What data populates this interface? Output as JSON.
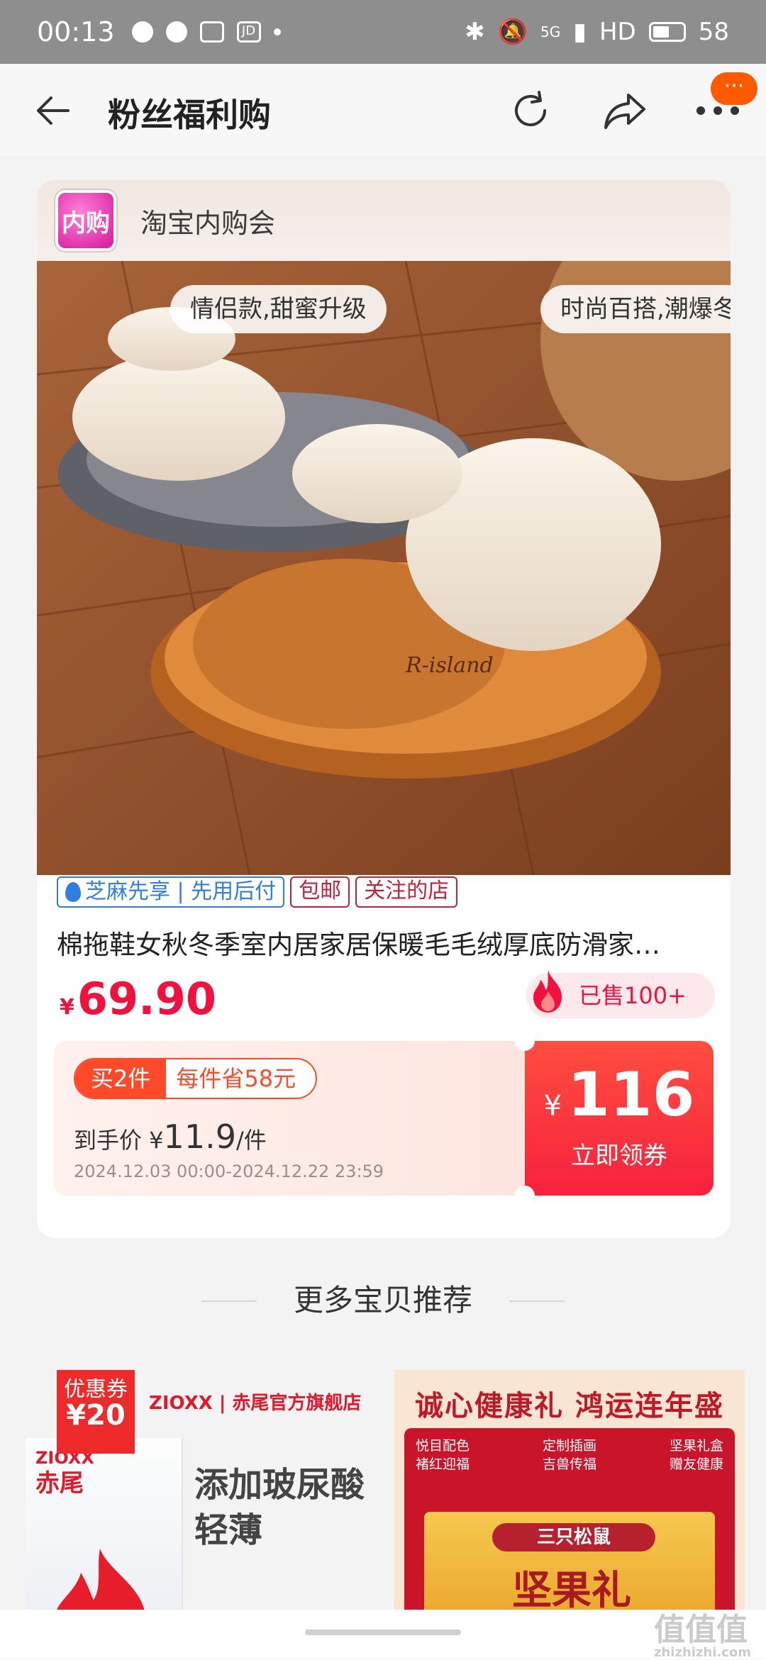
{
  "status_bar": {
    "time": "00:13",
    "network": "5G",
    "hd_label": "HD",
    "battery": "58",
    "jd_label": "JD"
  },
  "nav": {
    "title": "粉丝福利购",
    "badge": "···"
  },
  "shop": {
    "logo_text": "内购",
    "name": "淘宝内购会"
  },
  "product": {
    "tags": [
      "情侣款,甜蜜升级",
      "时尚百搭,潮爆冬"
    ],
    "shoe_brand_text": "R-island",
    "badges": {
      "zhima": "芝麻先享 | 先用后付",
      "free_ship": "包邮",
      "followed": "关注的店"
    },
    "title": "棉拖鞋女秋冬季室内居家居保暖毛毛绒厚底防滑家…",
    "price_symbol": "¥",
    "price": "69.90",
    "sold": "已售100+"
  },
  "coupon": {
    "buy_label": "买2件",
    "save_label": "每件省58元",
    "final_prefix": "到手价 ¥",
    "final_price": "11.9",
    "final_unit": "/件",
    "valid_range": "2024.12.03 00:00-2024.12.22 23:59",
    "amount_symbol": "¥",
    "amount": "116",
    "action": "立即领券"
  },
  "more": {
    "heading": "更多宝贝推荐"
  },
  "recommend": [
    {
      "coupon_label": "优惠券",
      "coupon_value": "¥20",
      "store": "ZIOXX | 赤尾官方旗舰店",
      "brand": "ZIOXX",
      "brand_cn": "赤尾",
      "text_line1": "添加玻尿酸",
      "text_line2": "轻薄"
    },
    {
      "title": "诚心健康礼 鸿运连年盛",
      "features": [
        [
          "悦目配色",
          "褚红迎福"
        ],
        [
          "定制插画",
          "吉兽传福"
        ],
        [
          "坚果礼盒",
          "赠友健康"
        ]
      ],
      "brand": "三只松鼠",
      "gift_text": "坚果礼"
    }
  ],
  "watermark": {
    "text": "值值值",
    "sub": "zhizhizhi.com"
  },
  "colors": {
    "accent_red": "#f0113f",
    "coupon_red": "#f7213e",
    "orange": "#ff5a00",
    "status_bar": "#8e8e8e"
  }
}
